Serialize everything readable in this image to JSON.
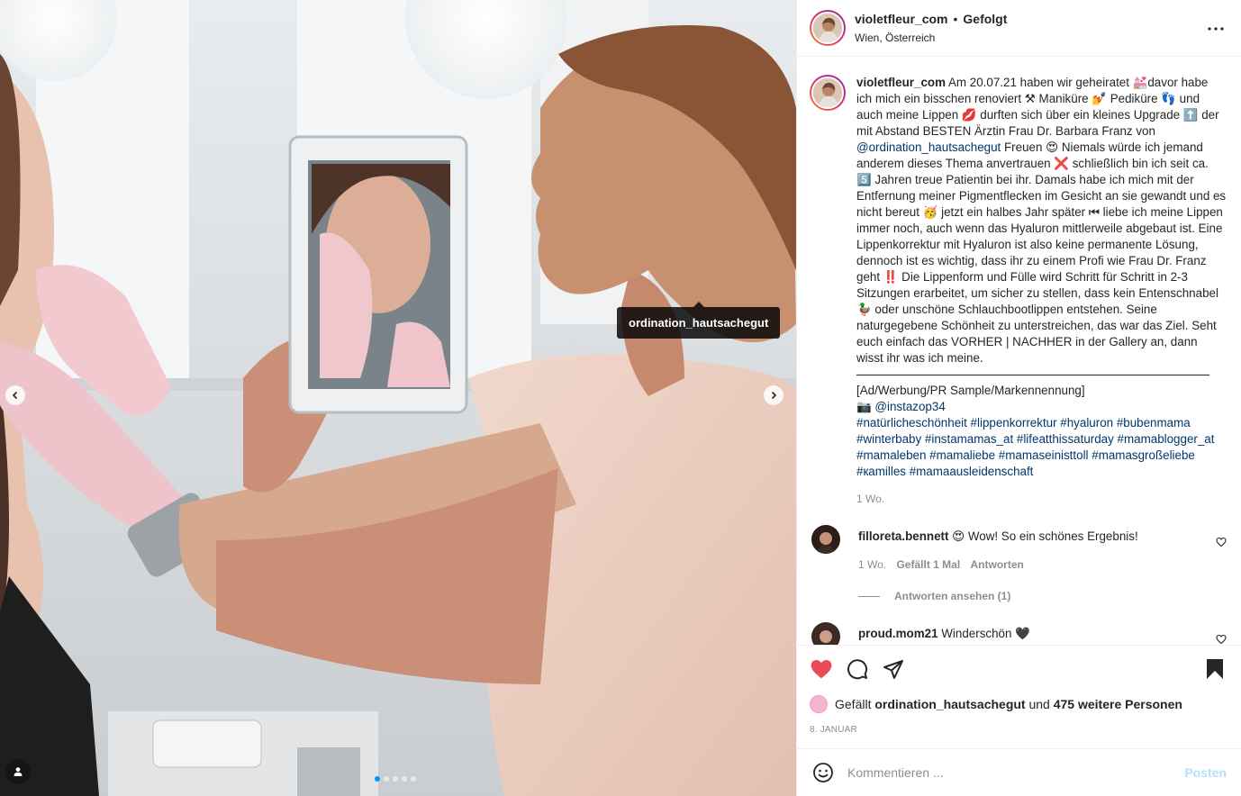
{
  "header": {
    "username": "violetfleur_com",
    "separator": "•",
    "follow_status": "Gefolgt",
    "location": "Wien, Österreich",
    "more_icon": "more-horizontal-icon"
  },
  "media": {
    "tag_label": "ordination_hautsachegut",
    "carousel": {
      "prev_icon": "chevron-left-icon",
      "next_icon": "chevron-right-icon"
    },
    "tags_icon": "user-tag-icon"
  },
  "caption": {
    "username": "violetfleur_com",
    "text_1": "Am 20.07.21 haben wir geheiratet 💒davor habe ich mich ein bisschen renoviert ⚒ Maniküre 💅 Pediküre 👣 und auch meine Lippen 💋 durften sich über ein kleines Upgrade ⬆️ der mit Abstand BESTEN Ärztin Frau Dr. Barbara Franz von ",
    "mention": "@ordination_hautsachegut",
    "text_2": " Freuen 😍 Niemals würde ich jemand anderem dieses Thema anvertrauen ❌ schließlich bin ich seit ca. 5️⃣ Jahren treue Patientin bei ihr. Damals habe ich mich mit der Entfernung meiner Pigmentflecken im Gesicht an sie gewandt und es nicht bereut 🥳 jetzt ein halbes Jahr später ⏮ liebe ich meine Lippen immer noch, auch wenn das Hyaluron mittlerweile abgebaut ist. Eine Lippenkorrektur mit Hyaluron ist also keine permanente Lösung, dennoch ist es wichtig, dass ihr zu einem Profi wie Frau Dr. Franz geht ‼️ Die Lippenform und Fülle wird Schritt für Schritt in 2-3 Sitzungen erarbeitet, um sicher zu stellen, dass kein Entenschnabel 🦆 oder unschöne Schlauchbootlippen entstehen. Seine naturgegebene Schönheit zu unterstreichen, das war das Ziel. Seht euch einfach das VORHER | NACHHER in der Gallery an, dann wisst ihr was ich meine.",
    "ad_line": "[Ad/Werbung/PR Sample/Markennennung]",
    "photo_credit_prefix": "📷 ",
    "photo_credit": "@instazop34",
    "hashtags": "#natürlicheschönheit #lippenkorrektur #hyaluron #bubenmama #winterbaby #instamamas_at #lifeatthissaturday #mamablogger_at #mamaleben #mamaliebe #mamaseinisttoll #mamasgroßeliebe #кamilles #mamaausleidenschaft",
    "age": "1 Wo."
  },
  "comments": [
    {
      "username": "filloreta.bennett",
      "text": "😍 Wow! So ein schönes Ergebnis!",
      "age": "1 Wo.",
      "likes": "Gefällt 1 Mal",
      "reply": "Antworten",
      "view_replies": "Antworten ansehen (1)"
    },
    {
      "username": "proud.mom21",
      "text": "Winderschön 🖤"
    }
  ],
  "actions": {
    "like_icon": "heart-filled-icon",
    "comment_icon": "comment-icon",
    "share_icon": "share-icon",
    "save_icon": "bookmark-filled-icon",
    "like_color": "#ed4956",
    "likes_prefix": "Gefällt ",
    "likes_user": "ordination_hautsachegut",
    "likes_mid": " und ",
    "likes_count": "475 weitere Personen",
    "date": "8. JANUAR"
  },
  "add_comment": {
    "placeholder": "Kommentieren ...",
    "post_label": "Posten",
    "emoji_icon": "smiley-icon"
  },
  "colors": {
    "link": "#00376b",
    "muted": "#8e8e8e",
    "post_button_disabled": "#b2dffc",
    "dot_active": "#0095f6"
  }
}
